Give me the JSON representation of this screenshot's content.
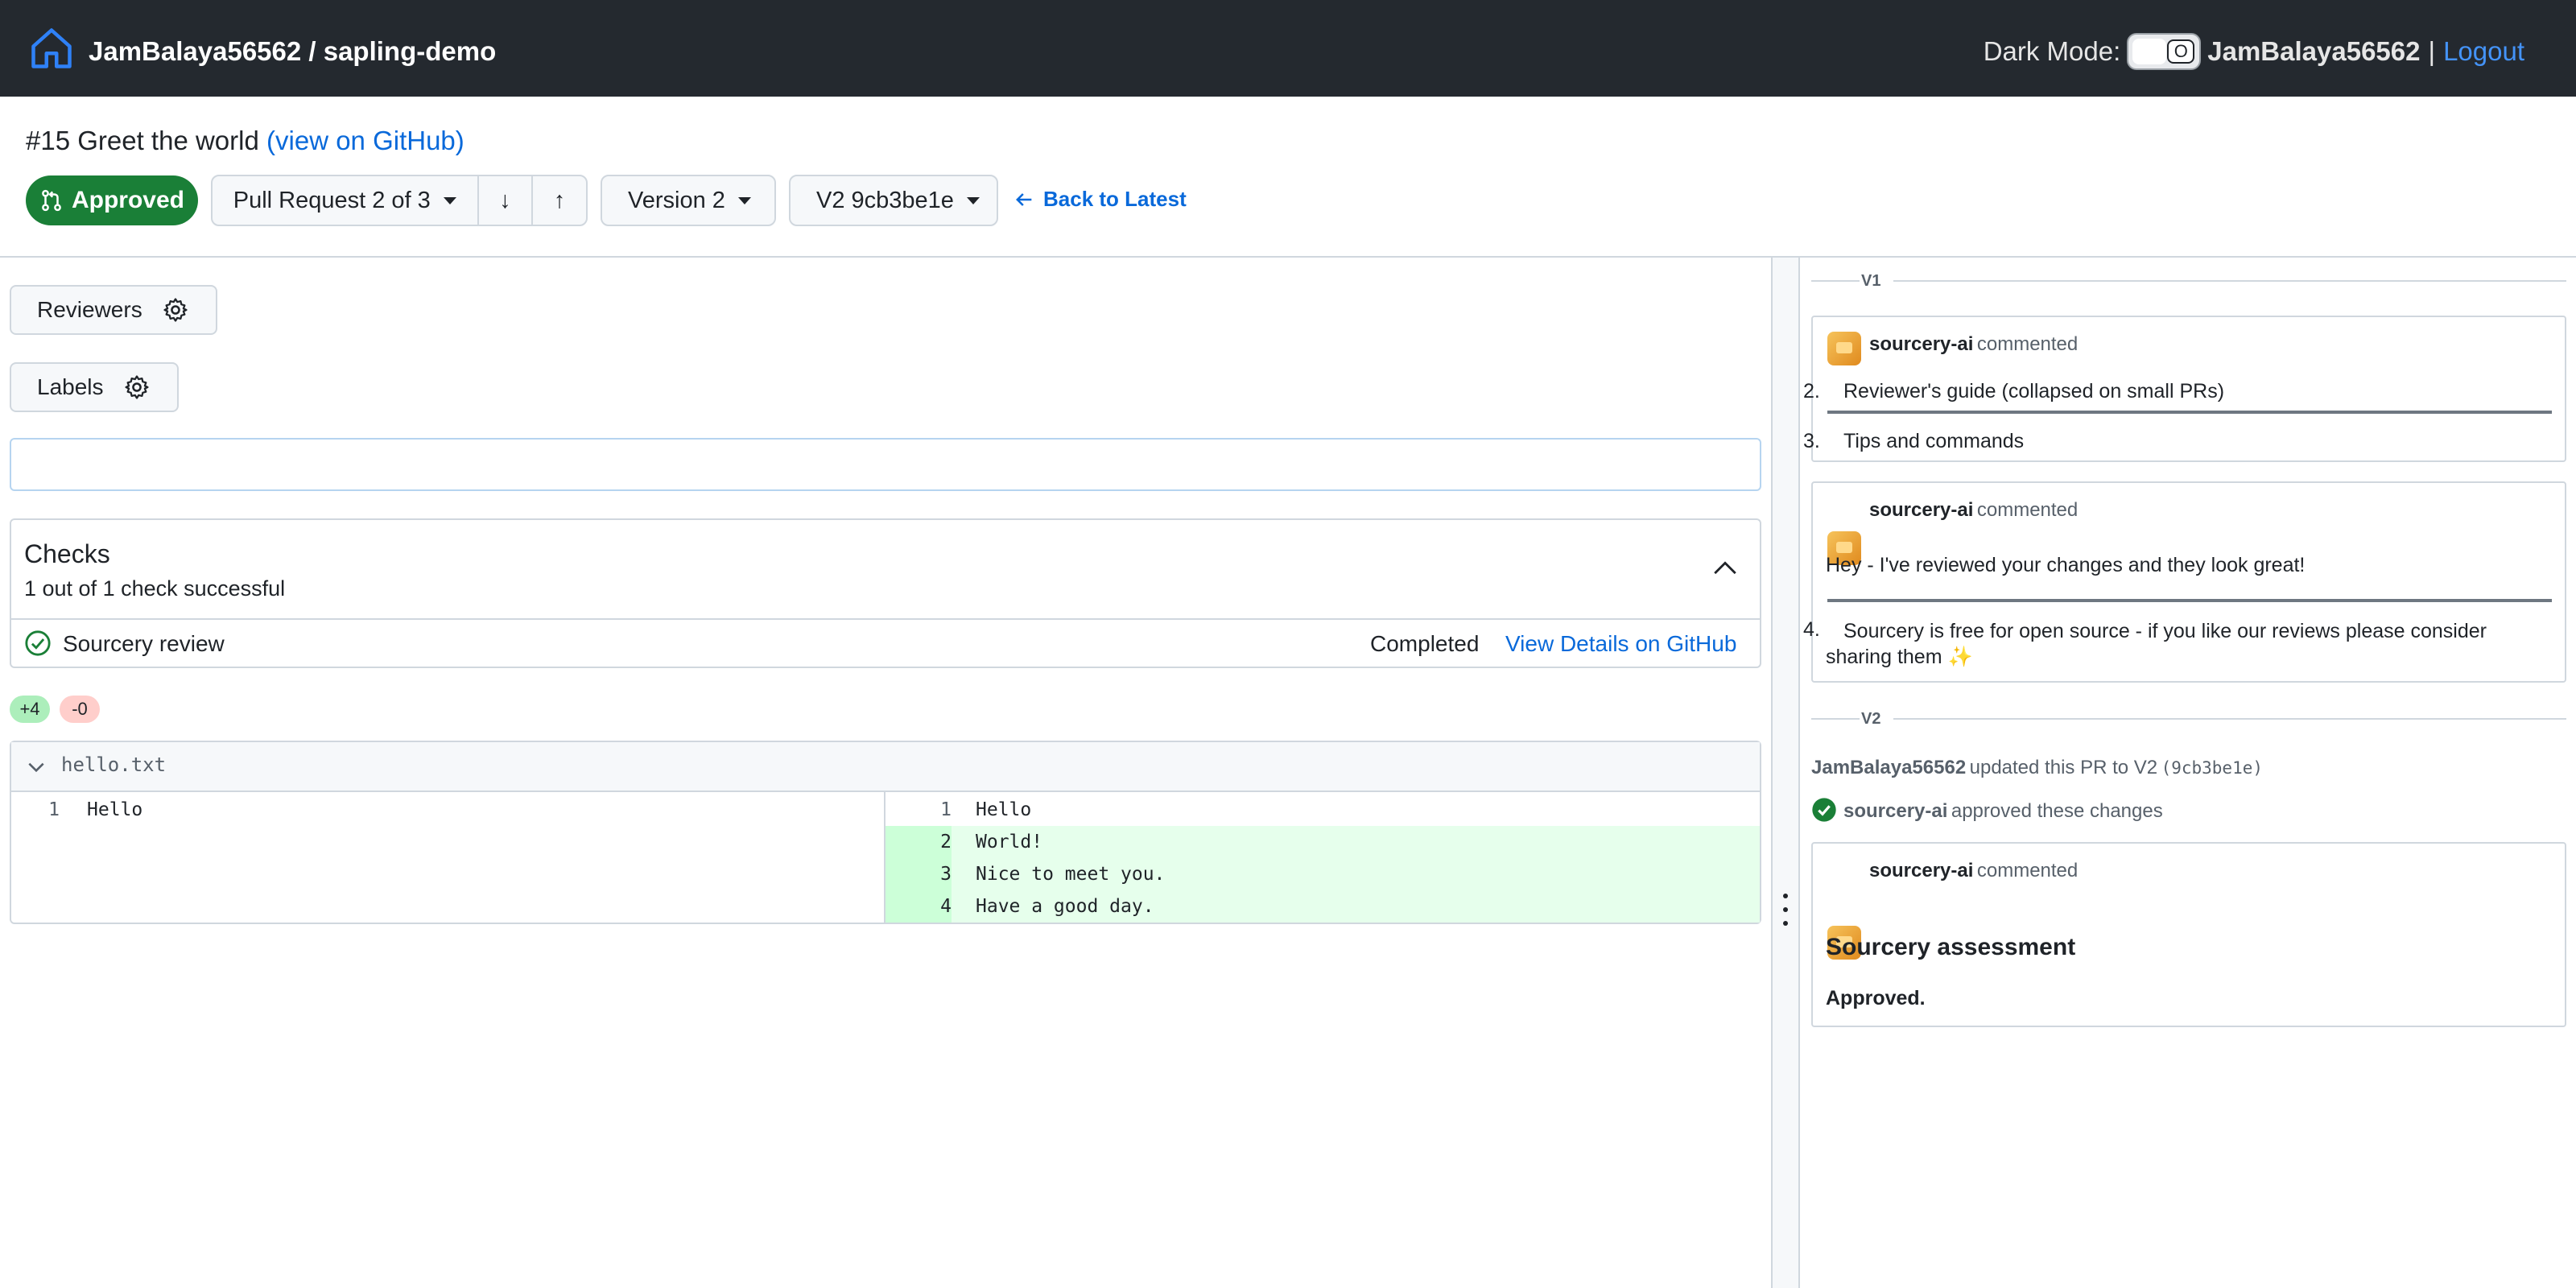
{
  "header": {
    "owner": "JamBalaya56562",
    "repo": "sapling-demo",
    "repo_title": "JamBalaya56562 / sapling-demo",
    "dark_mode_label": "Dark Mode:",
    "toggle_glyph": "O",
    "username": "JamBalaya56562",
    "separator": "|",
    "logout": "Logout"
  },
  "pr": {
    "title": "#15 Greet the world",
    "github_link": "(view on GitHub)",
    "status": "Approved",
    "nav_label": "Pull Request 2 of 3",
    "down_glyph": "↓",
    "up_glyph": "↑",
    "version": "Version 2",
    "commit": "V2 9cb3be1e",
    "back_to_latest": "Back to Latest"
  },
  "sidebar": {
    "reviewers": "Reviewers",
    "labels": "Labels"
  },
  "checks": {
    "title": "Checks",
    "summary": "1 out of 1 check successful",
    "items": [
      {
        "name": "Sourcery review",
        "status": "Completed",
        "link": "View Details on GitHub"
      }
    ]
  },
  "diff": {
    "additions": "+4",
    "deletions": "-0",
    "file": "hello.txt",
    "left_lines": [
      {
        "num": "1",
        "text": "Hello"
      }
    ],
    "right_lines": [
      {
        "num": "1",
        "text": "Hello",
        "added": false
      },
      {
        "num": "2",
        "text": "World!",
        "added": true
      },
      {
        "num": "3",
        "text": "Nice to meet you.",
        "added": true
      },
      {
        "num": "4",
        "text": "Have a good day.",
        "added": true
      }
    ]
  },
  "timeline": {
    "v1_label": "V1",
    "v2_label": "V2",
    "comment1": {
      "author": "sourcery-ai",
      "action": "commented",
      "items": [
        {
          "num": "2.",
          "text": "Reviewer's guide (collapsed on small PRs)"
        },
        {
          "num": "3.",
          "text": "Tips and commands"
        }
      ]
    },
    "comment2": {
      "author": "sourcery-ai",
      "action": "commented",
      "body": "Hey - I've reviewed your changes and they look great!",
      "item_num": "4.",
      "item_text": "Sourcery is free for open source - if you like our reviews please consider sharing them ✨"
    },
    "update_event": {
      "author": "JamBalaya56562",
      "text": "updated this PR to V2",
      "commit": "(9cb3be1e)"
    },
    "approve_event": {
      "author": "sourcery-ai",
      "text": "approved these changes"
    },
    "comment3": {
      "author": "sourcery-ai",
      "action": "commented",
      "heading": "Sourcery assessment",
      "body": "Approved."
    }
  },
  "colors": {
    "header_bg": "#24292f",
    "approved": "#1a7f37",
    "link": "#0969da",
    "added_bg": "#e6ffec",
    "removed_badge": "#ffcecb"
  },
  "icons": [
    "home-icon",
    "git-pull-request-icon",
    "gear-icon",
    "chevron-up-icon",
    "check-circle-icon",
    "chevron-down-icon",
    "arrow-left-icon",
    "arrow-down-icon",
    "arrow-up-icon",
    "kebab-icon"
  ]
}
